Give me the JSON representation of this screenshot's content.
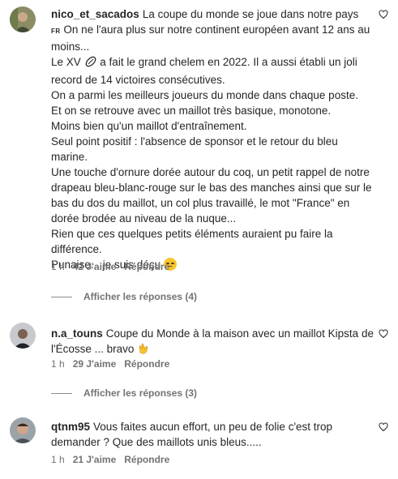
{
  "comments": [
    {
      "username": "nico_et_sacados",
      "text_lines": [
        "La coupe du monde se joue dans notre pays",
        "FR",
        " On ne l'aura plus sur notre continent européen avant 12 ans au moins...",
        "Le XV",
        " a fait le grand chelem en 2022. Il a aussi établi un joli record de 14 victoires consécutives.",
        "On a parmi les meilleurs joueurs du monde dans chaque poste.",
        "Et on se retrouve avec un maillot très basique, monotone.",
        "Moins bien qu'un maillot d'entraînement.",
        "Seul point positif : l'absence de sponsor et le retour du bleu marine.",
        "Une touche d'ornure dorée autour du coq, un petit rappel de notre drapeau bleu-blanc-rouge sur le bas des manches ainsi que sur le bas du dos du maillot, un col plus travaillé, le mot \"France\" en dorée brodée au niveau de la nuque...",
        "Rien que ces quelques petits éléments auraient pu faire la différence.",
        "Punaise... je suis déçu"
      ],
      "time": "1 h",
      "likes": "42 J'aime",
      "reply": "Répondre",
      "replies_label": "Afficher les réponses (4)"
    },
    {
      "username": "n.a_touns",
      "text": "Coupe du Monde à la maison avec un maillot Kipsta de l'Écosse ... bravo",
      "time": "1 h",
      "likes": "29 J'aime",
      "reply": "Répondre",
      "replies_label": "Afficher les réponses (3)"
    },
    {
      "username": "qtnm95",
      "text": "Vous faites aucun effort, un peu de folie c'est trop demander ? Que des maillots unis bleus.....",
      "time": "1 h",
      "likes": "21 J'aime",
      "reply": "Répondre"
    }
  ],
  "colors": {
    "text": "#262626",
    "muted": "#737373",
    "emoji": "#f7c52d"
  },
  "icons": [
    "heart-icon",
    "rugby-ball-icon",
    "disappointed-face-emoji",
    "clapping-hands-emoji"
  ]
}
